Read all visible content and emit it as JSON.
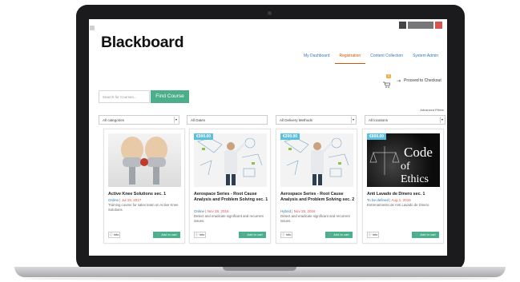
{
  "header": {
    "logo_text": "Blackboard",
    "nav": [
      {
        "label": "My Dashboard",
        "active": false
      },
      {
        "label": "Registration",
        "active": true
      },
      {
        "label": "Content Collection",
        "active": false
      },
      {
        "label": "System Admin",
        "active": false
      }
    ]
  },
  "cart": {
    "badge": "0",
    "checkout_label": "Proceed to Checkout"
  },
  "search": {
    "placeholder": "Search for Courses...",
    "button_label": "Find Course",
    "advanced_label": "Advanced Filters"
  },
  "filters": {
    "category": "All categories",
    "dates": "All Dates",
    "delivery": "All Delivery Methods",
    "locations": "All locations"
  },
  "cards": [
    {
      "title": "Active Knee Solutions sec. 1",
      "mode": "Online",
      "date": "Jul 19, 2017",
      "desc": "Training course for sales team on Active Knee Solutions",
      "price": "",
      "info_label": "Info",
      "add_label": "Add to cart"
    },
    {
      "title": "Aerospace Series - Root Cause Analysis and Problem Solving sec. 1",
      "mode": "Online",
      "date": "Nov 28, 2016",
      "desc": "Detect and eradicate significant and recurrent issues.",
      "price": "€500.00",
      "info_label": "Info",
      "add_label": "Add to cart"
    },
    {
      "title": "Aerospace Series - Root Cause Analysis and Problem Solving sec. 2",
      "mode": "Hybrid",
      "date": "Nov 28, 2016",
      "desc": "Detect and eradicate significant and recurrent issues.",
      "price": "€200.00",
      "info_label": "Info",
      "add_label": "Add to cart"
    },
    {
      "title": "Anti Lavado de Dinero sec. 1",
      "mode": "To be defined",
      "date": "Aug 1, 2016",
      "desc": "Entrenamiento de Anti Lavado de Dinero",
      "price": "€600.00",
      "image_text_1": "Code",
      "image_text_2": "of Ethics",
      "info_label": "Info",
      "add_label": "Add to cart"
    }
  ],
  "colors": {
    "accent_green": "#4caf8c",
    "nav_active": "#d35400",
    "link_blue": "#337ab7",
    "price_badge": "#5bc0de",
    "date_red": "#d9534f"
  }
}
